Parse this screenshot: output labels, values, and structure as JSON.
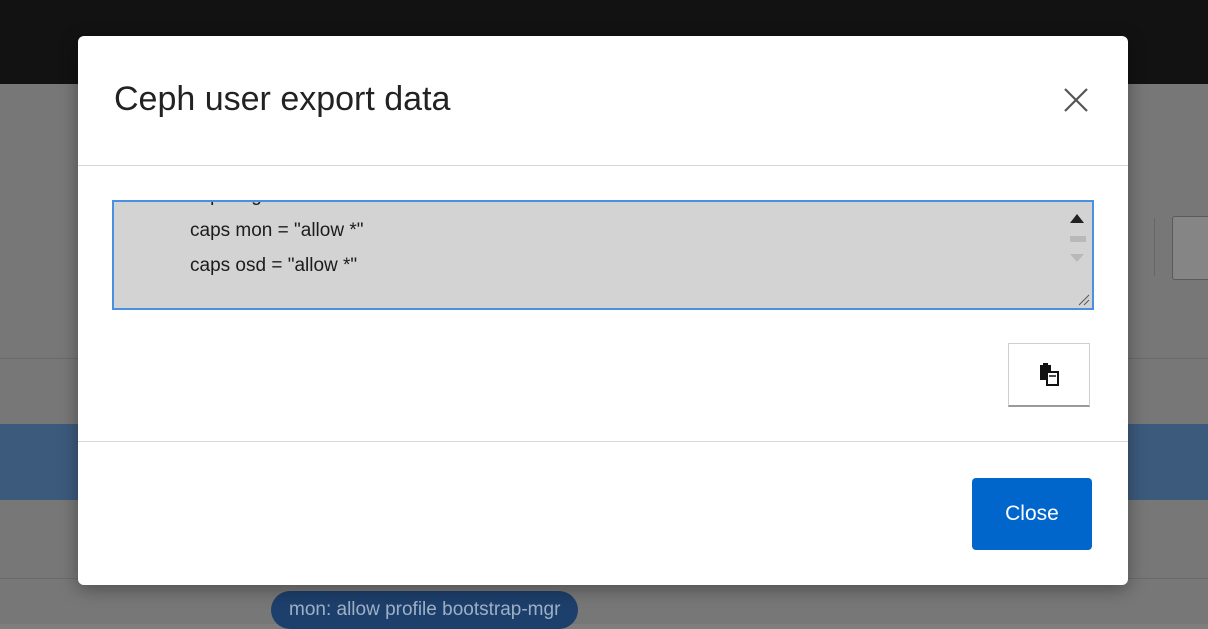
{
  "background": {
    "badge_text": "mon: allow profile bootstrap-mgr"
  },
  "modal": {
    "title": "Ceph user export data",
    "close_icon": "close-icon",
    "textarea": {
      "partial_line": "caps mgr = \"allow *\"",
      "lines": [
        "caps mon = \"allow *\"",
        "caps osd = \"allow *\""
      ]
    },
    "copy_icon": "clipboard-icon",
    "close_button_label": "Close"
  },
  "colors": {
    "primary": "#0066cc",
    "focus_border": "#4a90e2",
    "selected_row": "#3c5a7c",
    "badge": "#1d3f6b"
  }
}
